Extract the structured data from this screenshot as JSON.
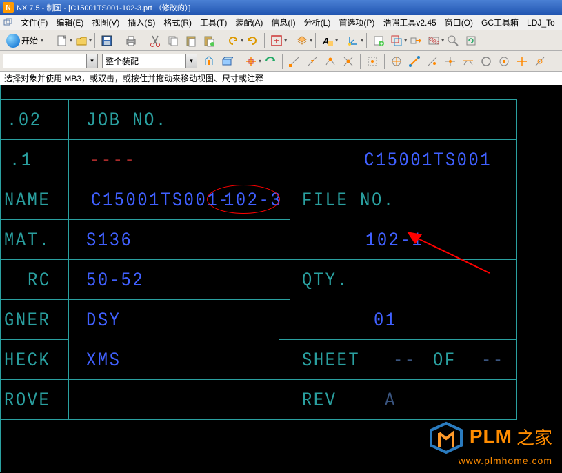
{
  "titlebar": {
    "text": "NX 7.5 - 制图 - [C15001TS001-102-3.prt （修改的）]"
  },
  "menubar": {
    "items": [
      "文件(F)",
      "编辑(E)",
      "视图(V)",
      "插入(S)",
      "格式(R)",
      "工具(T)",
      "装配(A)",
      "信息(I)",
      "分析(L)",
      "首选项(P)",
      "浩强工具v2.45",
      "窗口(O)",
      "GC工具箱",
      "LDJ_To"
    ]
  },
  "toolbar": {
    "start_label": "开始"
  },
  "toolbar2": {
    "combo1_value": "",
    "combo2_value": "整个装配"
  },
  "hint": "选择对象并使用 MB3，或双击，或按住并拖动来移动视图、尺寸或注释",
  "cad": {
    "r1c1": ".02",
    "r1c2": "JOB NO.",
    "r2c1": ".1",
    "r2c2": "----",
    "r2c3": "C15001TS001",
    "r3c1": "NAME",
    "r3c2a": "C15001TS001-",
    "r3c2b": "102-3",
    "r3c3": "FILE NO.",
    "r4c1": "MAT.",
    "r4c2": "S136",
    "r4c3": "102-1",
    "r5c1": "RC",
    "r5c2": "50-52",
    "r5c3": "QTY.",
    "r6c1": "GNER",
    "r6c2": "DSY",
    "r6c3": "01",
    "r7c1": "HECK",
    "r7c2": "XMS",
    "r7c3a": "SHEET",
    "r7c3b": "--",
    "r7c3c": "OF",
    "r7c3d": "--",
    "r8c1": "ROVE",
    "r8c3a": "REV",
    "r8c3b": "A"
  },
  "watermark": {
    "brand": "PLM",
    "zh": "之家",
    "url": "www.plmhome.com"
  }
}
